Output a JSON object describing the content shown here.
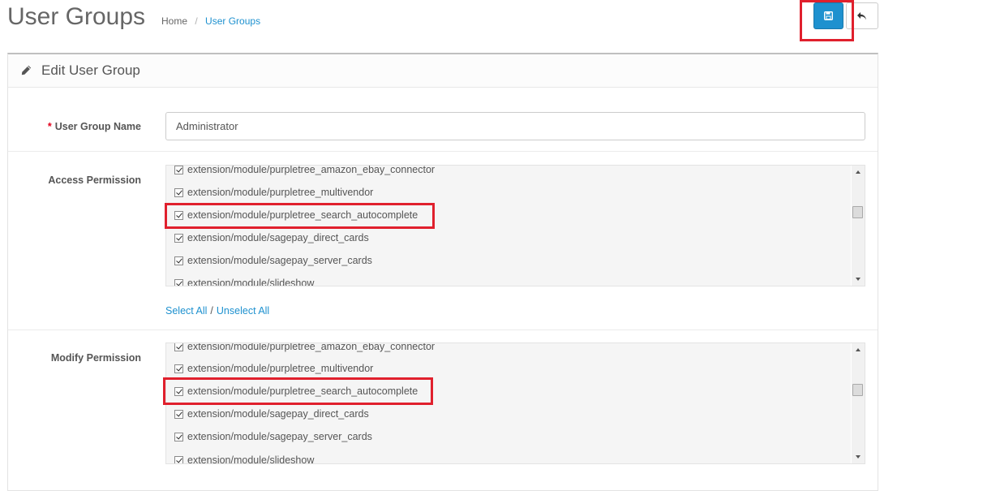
{
  "header": {
    "title": "User Groups",
    "breadcrumb": [
      {
        "label": "Home"
      },
      {
        "label": "User Groups"
      }
    ],
    "save_icon": "floppy-disk-icon",
    "back_icon": "reply-arrow-icon"
  },
  "panel": {
    "icon": "pencil-icon",
    "title": "Edit User Group"
  },
  "form": {
    "name": {
      "required_mark": "*",
      "label": "User Group Name",
      "value": "Administrator"
    },
    "access": {
      "label": "Access Permission",
      "items": [
        "extension/module/purpletree_amazon_ebay_connector",
        "extension/module/purpletree_multivendor",
        "extension/module/purpletree_search_autocomplete",
        "extension/module/sagepay_direct_cards",
        "extension/module/sagepay_server_cards",
        "extension/module/slideshow"
      ]
    },
    "select_all": "Select All",
    "separator": "/",
    "unselect_all": "Unselect All",
    "modify": {
      "label": "Modify Permission",
      "items": [
        "extension/module/purpletree_amazon_ebay_connector",
        "extension/module/purpletree_multivendor",
        "extension/module/purpletree_search_autocomplete",
        "extension/module/sagepay_direct_cards",
        "extension/module/sagepay_server_cards",
        "extension/module/slideshow"
      ]
    }
  },
  "colors": {
    "primary": "#1e91cf",
    "highlight": "#e0202d",
    "required": "#e3001b"
  }
}
